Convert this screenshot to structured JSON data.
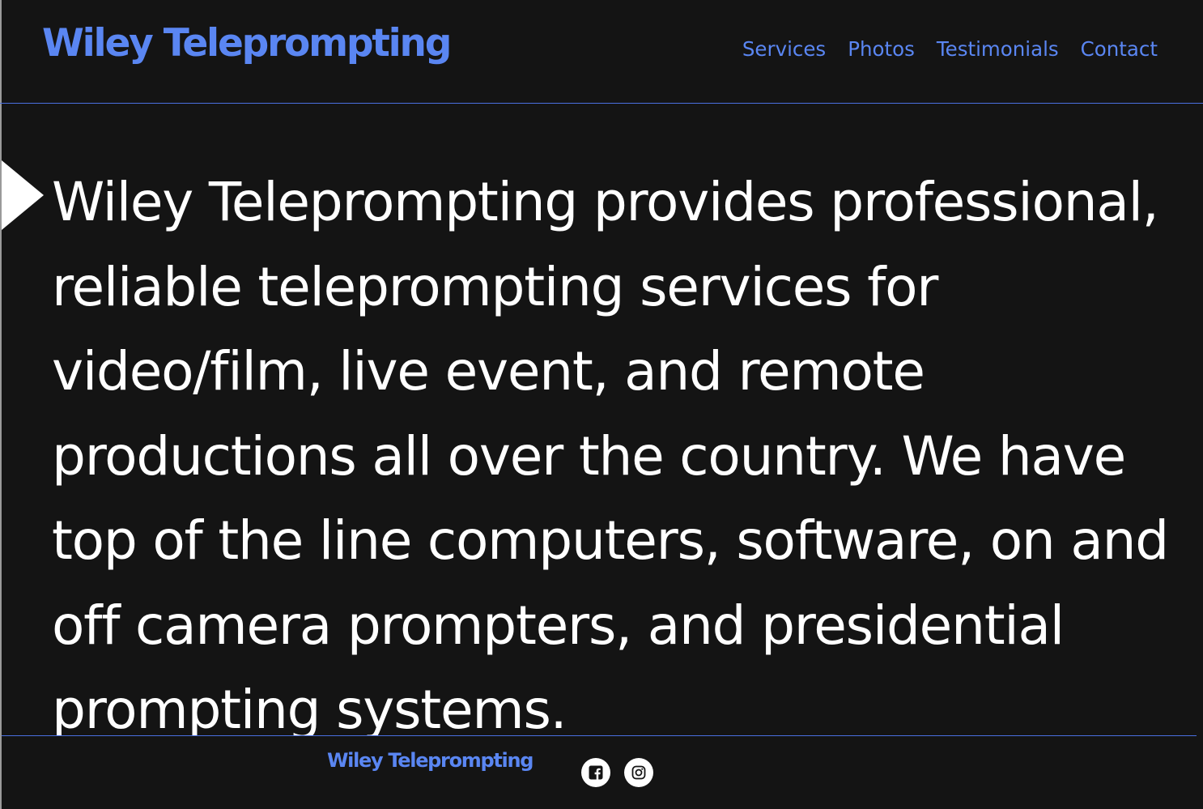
{
  "header": {
    "brand": "Wiley Teleprompting",
    "nav": [
      {
        "label": "Services"
      },
      {
        "label": "Photos"
      },
      {
        "label": "Testimonials"
      },
      {
        "label": "Contact"
      }
    ]
  },
  "hero": {
    "text": "Wiley Teleprompting provides professional, reliable teleprompting services for video/film, live event, and remote productions all over the country. We have top of the line computers, software, on and off camera prompters, and presidential prompting systems."
  },
  "footer": {
    "brand": "Wiley Teleprompting",
    "social": [
      {
        "icon": "facebook-icon"
      },
      {
        "icon": "instagram-icon"
      }
    ]
  },
  "colors": {
    "background": "#141414",
    "accent": "#5a86f2",
    "text": "#ffffff",
    "rule": "#4a6fe0"
  }
}
